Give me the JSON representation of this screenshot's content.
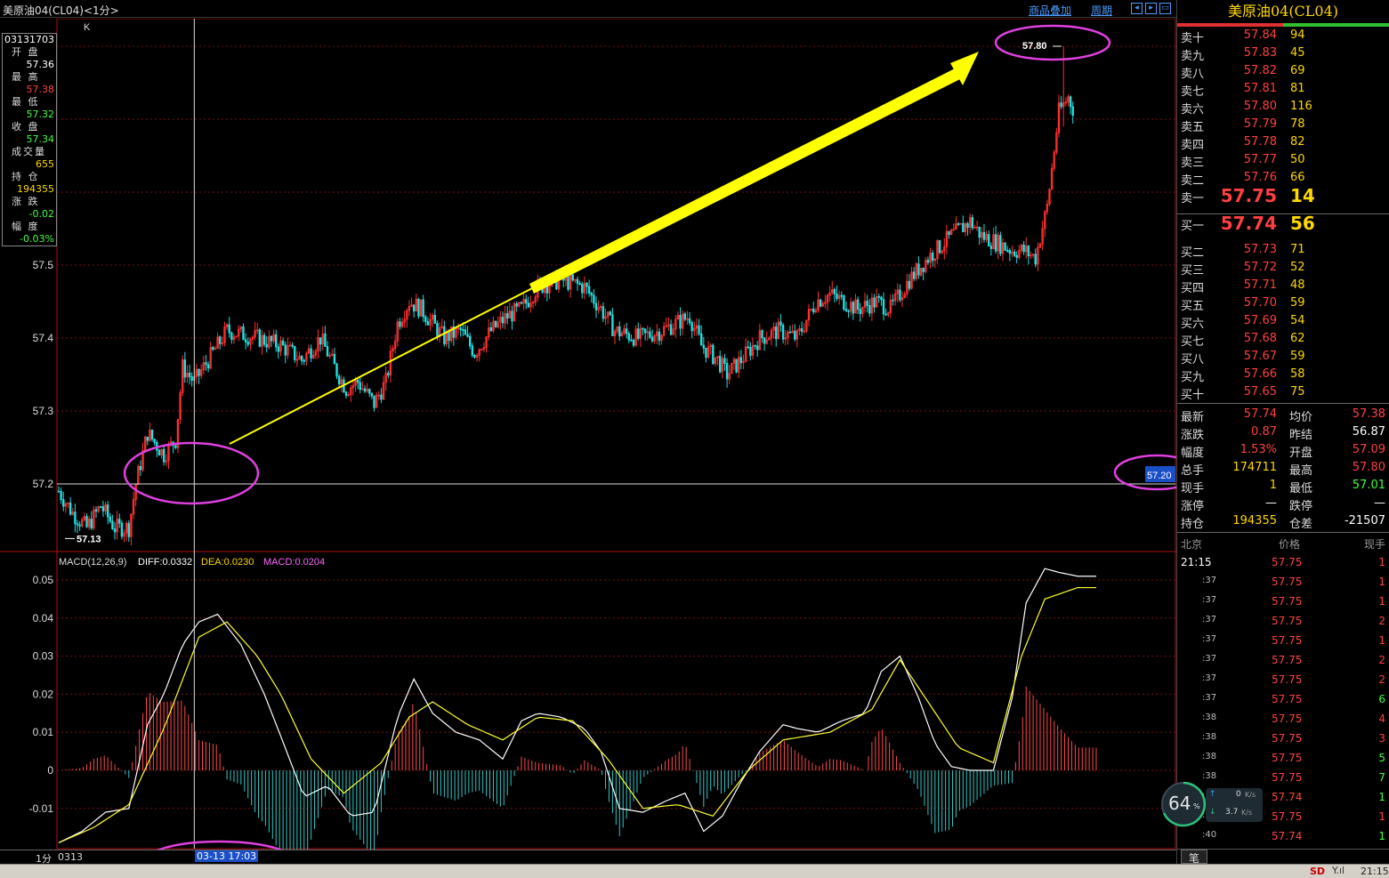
{
  "title": "美原油04(CL04)<1分>",
  "header_links": {
    "overlay": "商品叠加",
    "period": "周期"
  },
  "info_box": {
    "time": "03131703",
    "rows": [
      {
        "label": "开 盘",
        "value": "57.36",
        "color": "#ffffff"
      },
      {
        "label": "最 高",
        "value": "57.38",
        "color": "#ff4040"
      },
      {
        "label": "最 低",
        "value": "57.32",
        "color": "#40ff40"
      },
      {
        "label": "收 盘",
        "value": "57.34",
        "color": "#40ff40"
      },
      {
        "label": "成交量",
        "value": "655",
        "color": "#ffd700"
      },
      {
        "label": "持 仓",
        "value": "194355",
        "color": "#ffd700"
      },
      {
        "label": "涨 跌",
        "value": "-0.02",
        "color": "#40ff40"
      },
      {
        "label": "幅 度",
        "value": "-0.03%",
        "color": "#40ff40"
      }
    ]
  },
  "chart_data": [
    {
      "type": "candlestick",
      "k_label": "K",
      "y_ticks": [
        "57.5",
        "57.4",
        "57.3",
        "57.2"
      ],
      "ylim": [
        57.12,
        57.82
      ],
      "annotations": {
        "low": "57.13",
        "high": "57.80",
        "crosshair_price": "57.20"
      },
      "price_path": [
        [
          0,
          57.19
        ],
        [
          6,
          57.16
        ],
        [
          12,
          57.14
        ],
        [
          18,
          57.17
        ],
        [
          24,
          57.14
        ],
        [
          30,
          57.14
        ],
        [
          33,
          57.2
        ],
        [
          38,
          57.27
        ],
        [
          45,
          57.24
        ],
        [
          50,
          57.26
        ],
        [
          53,
          57.36
        ],
        [
          58,
          57.34
        ],
        [
          66,
          57.38
        ],
        [
          72,
          57.41
        ],
        [
          85,
          57.4
        ],
        [
          95,
          57.39
        ],
        [
          104,
          57.37
        ],
        [
          112,
          57.4
        ],
        [
          118,
          57.36
        ],
        [
          123,
          57.33
        ],
        [
          128,
          57.34
        ],
        [
          135,
          57.31
        ],
        [
          140,
          57.34
        ],
        [
          145,
          57.42
        ],
        [
          150,
          57.45
        ],
        [
          155,
          57.44
        ],
        [
          165,
          57.4
        ],
        [
          172,
          57.41
        ],
        [
          178,
          57.38
        ],
        [
          185,
          57.41
        ],
        [
          192,
          57.43
        ],
        [
          198,
          57.44
        ],
        [
          205,
          57.47
        ],
        [
          215,
          57.48
        ],
        [
          225,
          57.47
        ],
        [
          232,
          57.44
        ],
        [
          238,
          57.41
        ],
        [
          248,
          57.4
        ],
        [
          258,
          57.41
        ],
        [
          270,
          57.43
        ],
        [
          275,
          57.39
        ],
        [
          282,
          57.37
        ],
        [
          286,
          57.35
        ],
        [
          292,
          57.37
        ],
        [
          300,
          57.4
        ],
        [
          308,
          57.41
        ],
        [
          316,
          57.4
        ],
        [
          324,
          57.45
        ],
        [
          330,
          57.46
        ],
        [
          336,
          57.45
        ],
        [
          342,
          57.44
        ],
        [
          350,
          57.45
        ],
        [
          356,
          57.44
        ],
        [
          364,
          57.48
        ],
        [
          372,
          57.51
        ],
        [
          382,
          57.54
        ],
        [
          390,
          57.56
        ],
        [
          395,
          57.54
        ],
        [
          402,
          57.53
        ],
        [
          408,
          57.52
        ],
        [
          413,
          57.52
        ],
        [
          418,
          57.51
        ],
        [
          423,
          57.58
        ],
        [
          428,
          57.71
        ],
        [
          432,
          57.73
        ],
        [
          436,
          57.7
        ],
        [
          440,
          57.73
        ],
        [
          444,
          57.74
        ]
      ],
      "macd": {
        "label": "MACD(12,26,9)",
        "diff_label": "DIFF:0.0332",
        "dea_label": "DEA:0.0230",
        "macd_label": "MACD:0.0204",
        "y_ticks": [
          "0.05",
          "0.04",
          "0.03",
          "0.02",
          "0.01",
          "0",
          "-0.01"
        ],
        "diff": [
          [
            0,
            -0.019
          ],
          [
            10,
            -0.016
          ],
          [
            20,
            -0.011
          ],
          [
            30,
            -0.01
          ],
          [
            38,
            0.012
          ],
          [
            45,
            0.02
          ],
          [
            53,
            0.033
          ],
          [
            60,
            0.039
          ],
          [
            68,
            0.041
          ],
          [
            78,
            0.033
          ],
          [
            88,
            0.02
          ],
          [
            95,
            0.009
          ],
          [
            105,
            -0.007
          ],
          [
            115,
            -0.004
          ],
          [
            125,
            -0.012
          ],
          [
            135,
            -0.011
          ],
          [
            145,
            0.014
          ],
          [
            152,
            0.024
          ],
          [
            160,
            0.015
          ],
          [
            170,
            0.01
          ],
          [
            180,
            0.008
          ],
          [
            190,
            0.003
          ],
          [
            198,
            0.013
          ],
          [
            205,
            0.015
          ],
          [
            215,
            0.014
          ],
          [
            225,
            0.011
          ],
          [
            232,
            0.005
          ],
          [
            240,
            -0.01
          ],
          [
            250,
            -0.011
          ],
          [
            260,
            -0.008
          ],
          [
            268,
            -0.006
          ],
          [
            276,
            -0.016
          ],
          [
            284,
            -0.012
          ],
          [
            292,
            -0.003
          ],
          [
            300,
            0.005
          ],
          [
            310,
            0.012
          ],
          [
            316,
            0.011
          ],
          [
            325,
            0.01
          ],
          [
            335,
            0.013
          ],
          [
            345,
            0.015
          ],
          [
            352,
            0.026
          ],
          [
            360,
            0.03
          ],
          [
            368,
            0.019
          ],
          [
            375,
            0.007
          ],
          [
            382,
            0.001
          ],
          [
            390,
            0.0
          ],
          [
            396,
            0.0
          ],
          [
            400,
            0.0
          ],
          [
            408,
            0.019
          ],
          [
            414,
            0.044
          ],
          [
            422,
            0.053
          ],
          [
            428,
            0.052
          ],
          [
            436,
            0.051
          ]
        ],
        "dea": [
          [
            0,
            -0.019
          ],
          [
            15,
            -0.015
          ],
          [
            30,
            -0.009
          ],
          [
            45,
            0.011
          ],
          [
            60,
            0.035
          ],
          [
            72,
            0.039
          ],
          [
            85,
            0.03
          ],
          [
            95,
            0.02
          ],
          [
            108,
            0.003
          ],
          [
            122,
            -0.006
          ],
          [
            138,
            0.002
          ],
          [
            150,
            0.014
          ],
          [
            160,
            0.018
          ],
          [
            175,
            0.012
          ],
          [
            190,
            0.008
          ],
          [
            205,
            0.014
          ],
          [
            220,
            0.013
          ],
          [
            235,
            0.003
          ],
          [
            250,
            -0.01
          ],
          [
            265,
            -0.009
          ],
          [
            280,
            -0.012
          ],
          [
            295,
            0.0
          ],
          [
            310,
            0.008
          ],
          [
            330,
            0.01
          ],
          [
            348,
            0.016
          ],
          [
            360,
            0.029
          ],
          [
            372,
            0.018
          ],
          [
            385,
            0.006
          ],
          [
            400,
            0.002
          ],
          [
            412,
            0.03
          ],
          [
            422,
            0.045
          ],
          [
            436,
            0.048
          ]
        ]
      },
      "x_labels": {
        "period": "1分",
        "start": "0313",
        "crosshair_time": "03-13 17:03"
      }
    }
  ],
  "panel": {
    "title": "美原油04(CL04)",
    "asks": [
      {
        "label": "卖十",
        "price": "57.84",
        "vol": "94"
      },
      {
        "label": "卖九",
        "price": "57.83",
        "vol": "45"
      },
      {
        "label": "卖八",
        "price": "57.82",
        "vol": "69"
      },
      {
        "label": "卖七",
        "price": "57.81",
        "vol": "81"
      },
      {
        "label": "卖六",
        "price": "57.80",
        "vol": "116"
      },
      {
        "label": "卖五",
        "price": "57.79",
        "vol": "78"
      },
      {
        "label": "卖四",
        "price": "57.78",
        "vol": "82"
      },
      {
        "label": "卖三",
        "price": "57.77",
        "vol": "50"
      },
      {
        "label": "卖二",
        "price": "57.76",
        "vol": "66"
      }
    ],
    "ask1": {
      "label": "卖一",
      "price": "57.75",
      "vol": "14"
    },
    "bid1": {
      "label": "买一",
      "price": "57.74",
      "vol": "56"
    },
    "bids": [
      {
        "label": "买二",
        "price": "57.73",
        "vol": "71"
      },
      {
        "label": "买三",
        "price": "57.72",
        "vol": "52"
      },
      {
        "label": "买四",
        "price": "57.71",
        "vol": "48"
      },
      {
        "label": "买五",
        "price": "57.70",
        "vol": "59"
      },
      {
        "label": "买六",
        "price": "57.69",
        "vol": "54"
      },
      {
        "label": "买七",
        "price": "57.68",
        "vol": "62"
      },
      {
        "label": "买八",
        "price": "57.67",
        "vol": "59"
      },
      {
        "label": "买九",
        "price": "57.66",
        "vol": "58"
      },
      {
        "label": "买十",
        "price": "57.65",
        "vol": "75"
      }
    ],
    "stats": [
      {
        "l1": "最新",
        "v1": "57.74",
        "c1": "#ff4040",
        "l2": "均价",
        "v2": "57.38",
        "c2": "#ff4040"
      },
      {
        "l1": "涨跌",
        "v1": "0.87",
        "c1": "#ff4040",
        "l2": "昨结",
        "v2": "56.87",
        "c2": "#ffffff"
      },
      {
        "l1": "幅度",
        "v1": "1.53%",
        "c1": "#ff4040",
        "l2": "开盘",
        "v2": "57.09",
        "c2": "#ff4040"
      },
      {
        "l1": "总手",
        "v1": "174711",
        "c1": "#ffd700",
        "l2": "最高",
        "v2": "57.80",
        "c2": "#ff4040"
      },
      {
        "l1": "现手",
        "v1": "1",
        "c1": "#ffd700",
        "l2": "最低",
        "v2": "57.01",
        "c2": "#40ff40"
      },
      {
        "l1": "涨停",
        "v1": "—",
        "c1": "#ffffff",
        "l2": "跌停",
        "v2": "—",
        "c2": "#ffffff"
      },
      {
        "l1": "持仓",
        "v1": "194355",
        "c1": "#ffd700",
        "l2": "仓差",
        "v2": "-21507",
        "c2": "#ffffff"
      }
    ],
    "tick_header": {
      "time": "北京",
      "price": "价格",
      "vol": "现手"
    },
    "ticks": [
      {
        "t": "21:15",
        "p": "57.75",
        "v": "1",
        "vc": "#ff4040"
      },
      {
        "t": ":37",
        "p": "57.75",
        "v": "1",
        "vc": "#ff4040"
      },
      {
        "t": ":37",
        "p": "57.75",
        "v": "1",
        "vc": "#ff4040"
      },
      {
        "t": ":37",
        "p": "57.75",
        "v": "2",
        "vc": "#ff4040"
      },
      {
        "t": ":37",
        "p": "57.75",
        "v": "1",
        "vc": "#ff4040"
      },
      {
        "t": ":37",
        "p": "57.75",
        "v": "2",
        "vc": "#ff4040"
      },
      {
        "t": ":37",
        "p": "57.75",
        "v": "2",
        "vc": "#ff4040"
      },
      {
        "t": ":37",
        "p": "57.75",
        "v": "6",
        "vc": "#40ff40"
      },
      {
        "t": ":38",
        "p": "57.75",
        "v": "4",
        "vc": "#ff4040"
      },
      {
        "t": ":38",
        "p": "57.75",
        "v": "3",
        "vc": "#ff4040"
      },
      {
        "t": ":38",
        "p": "57.75",
        "v": "5",
        "vc": "#40ff40"
      },
      {
        "t": ":38",
        "p": "57.75",
        "v": "7",
        "vc": "#40ff40"
      },
      {
        "t": ":38",
        "p": "57.74",
        "v": "1",
        "vc": "#40ff40"
      },
      {
        "t": ":38",
        "p": "57.75",
        "v": "1",
        "vc": "#ff4040"
      },
      {
        "t": ":40",
        "p": "57.74",
        "v": "1",
        "vc": "#40ff40"
      }
    ],
    "tab": "笔"
  },
  "speed_widget": {
    "percent": "64",
    "unit": "%",
    "up": "0",
    "up_unit": "K/s",
    "down": "3.7",
    "down_unit": "K/s"
  },
  "status": {
    "sd": "SD",
    "time": "21:15"
  }
}
